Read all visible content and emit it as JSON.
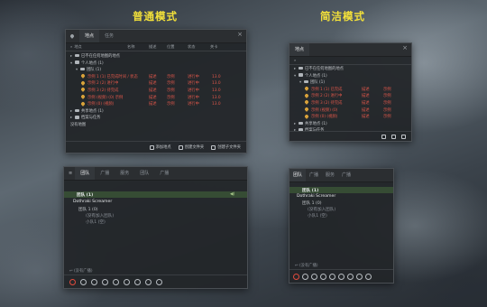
{
  "titles": {
    "normal": "普通模式",
    "simple": "简洁模式"
  },
  "points_panel": {
    "tabs": [
      "地点",
      "任务"
    ],
    "columns": [
      "名称",
      "描述",
      "位置",
      "状态",
      "关卡"
    ],
    "search_label": "地点",
    "rows": [
      {
        "label": "已不在任何地图的地点",
        "level": 0,
        "arrow": "▸",
        "kind": "folder"
      },
      {
        "label": "个人地点 (1)",
        "level": 0,
        "arrow": "▾",
        "kind": "folder"
      },
      {
        "label": "团队 (1)",
        "level": 1,
        "arrow": "▾",
        "kind": "folder"
      },
      {
        "label": "示例 1 (1) 已完成时间 / 状态",
        "level": 2,
        "kind": "point",
        "red": true,
        "c2": "描述",
        "c3": "示例",
        "c4": "进行中",
        "c5": "13.0"
      },
      {
        "label": "示例 2 (2) 进行中",
        "level": 2,
        "kind": "point",
        "red": true,
        "c2": "描述",
        "c3": "示例",
        "c4": "进行中",
        "c5": "13.0"
      },
      {
        "label": "示例 3 (2) 待完成",
        "level": 2,
        "kind": "point",
        "red": true,
        "c2": "描述",
        "c3": "示例",
        "c4": "进行中",
        "c5": "13.0"
      },
      {
        "label": "示例 (视频) (0) 示例",
        "level": 2,
        "kind": "point",
        "red": true,
        "c2": "描述",
        "c3": "示例",
        "c4": "进行中",
        "c5": "13.0"
      },
      {
        "label": "示例 (0) (视频)",
        "level": 2,
        "kind": "point",
        "red": true,
        "c2": "描述",
        "c3": "示例",
        "c4": "进行中",
        "c5": "13.0"
      },
      {
        "label": "共享地点 (1)",
        "level": 0,
        "arrow": "▸",
        "kind": "folder"
      },
      {
        "label": "档案与任务",
        "level": 0,
        "arrow": "▸",
        "kind": "folder"
      },
      {
        "label": "没有地图",
        "level": 0,
        "kind": "plain"
      }
    ],
    "footer_buttons": [
      "添加地点",
      "创建文件夹",
      "创建子文件夹"
    ]
  },
  "points_compact": {
    "tabs": [
      "地点"
    ],
    "rows": [
      {
        "label": "已不在任何地图的地点",
        "level": 0,
        "arrow": "▸",
        "kind": "folder"
      },
      {
        "label": "个人地点 (1)",
        "level": 0,
        "arrow": "▾",
        "kind": "folder"
      },
      {
        "label": "团队 (1)",
        "level": 1,
        "arrow": "▾",
        "kind": "folder"
      },
      {
        "label": "示例 1 (1) 已完成",
        "level": 2,
        "kind": "point",
        "red": true,
        "c2": "描述",
        "c3": "示例"
      },
      {
        "label": "示例 2 (2) 进行中",
        "level": 2,
        "kind": "point",
        "red": true,
        "c2": "描述",
        "c3": "示例"
      },
      {
        "label": "示例 3 (2) 待完成",
        "level": 2,
        "kind": "point",
        "red": true,
        "c2": "描述",
        "c3": "示例"
      },
      {
        "label": "示例 (视频) (0)",
        "level": 2,
        "kind": "point",
        "red": true,
        "c2": "描述",
        "c3": "示例"
      },
      {
        "label": "示例 (0) (视频)",
        "level": 2,
        "kind": "point",
        "red": true,
        "c2": "描述",
        "c3": "示例"
      },
      {
        "label": "共享地点 (1)",
        "level": 0,
        "arrow": "▸",
        "kind": "folder"
      },
      {
        "label": "档案与任务",
        "level": 0,
        "arrow": "▸",
        "kind": "folder"
      }
    ]
  },
  "channel_panel": {
    "tabs": [
      "团队",
      "广播",
      "服务",
      "团队",
      "广播"
    ],
    "team_header": "团队 (1)",
    "user": "Dothraki Screamer",
    "sub_team": "团队 1 (0)",
    "sub1": "(没有加入团队)",
    "sub2": "小队1 (空)",
    "channel_label": "(没有广播)"
  },
  "channel_compact": {
    "tabs": [
      "团队",
      "广播",
      "服务",
      "广播"
    ],
    "team_header": "团队 (1)",
    "user": "Dothraki Screamer",
    "sub_team": "团队 1 (0)",
    "sub1": "(没有加入团队)",
    "sub2": "小队1 (空)",
    "channel_label": "(没有广播)"
  }
}
